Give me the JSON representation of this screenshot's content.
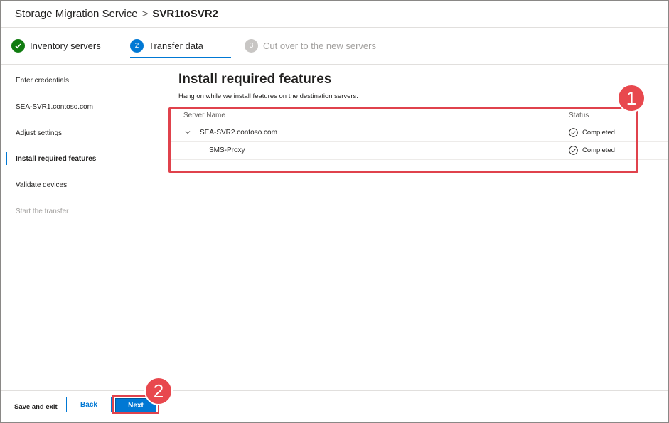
{
  "header": {
    "root": "Storage Migration Service",
    "separator": ">",
    "current": "SVR1toSVR2"
  },
  "stepper": [
    {
      "number": "",
      "label": "Inventory servers",
      "state": "done"
    },
    {
      "number": "2",
      "label": "Transfer data",
      "state": "active"
    },
    {
      "number": "3",
      "label": "Cut over to the new servers",
      "state": "disabled"
    }
  ],
  "nav": [
    {
      "label": "Enter credentials",
      "state": "normal"
    },
    {
      "label": "SEA-SVR1.contoso.com",
      "state": "normal"
    },
    {
      "label": "Adjust settings",
      "state": "normal"
    },
    {
      "label": "Install required features",
      "state": "active"
    },
    {
      "label": "Validate devices",
      "state": "normal"
    },
    {
      "label": "Start the transfer",
      "state": "disabled"
    }
  ],
  "main": {
    "title": "Install required features",
    "description": "Hang on while we install features on the destination servers.",
    "table": {
      "headers": {
        "name": "Server Name",
        "status": "Status"
      },
      "rows": [
        {
          "name": "SEA-SVR2.contoso.com",
          "status": "Completed",
          "expandable": true
        },
        {
          "name": "SMS-Proxy",
          "status": "Completed",
          "expandable": false
        }
      ]
    }
  },
  "annotations": {
    "badge1": "1",
    "badge2": "2",
    "color": "#e0424c"
  },
  "footer": {
    "save_exit": "Save and exit",
    "back": "Back",
    "next": "Next"
  },
  "colors": {
    "accent": "#0078d4",
    "success": "#107c10",
    "disabled": "#a19f9d"
  }
}
